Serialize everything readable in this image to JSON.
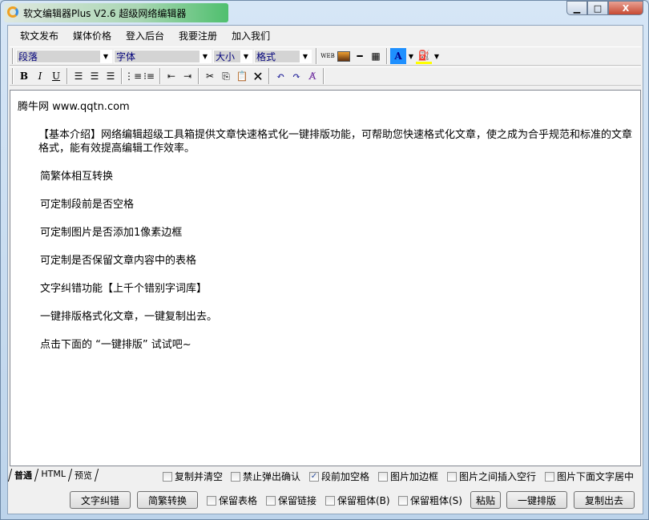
{
  "window": {
    "title": "软文编辑器Plus V2.6 超级网络编辑器",
    "min": "▁",
    "max": "□",
    "close": "X"
  },
  "menu": [
    "软文发布",
    "媒体价格",
    "登入后台",
    "我要注册",
    "加入我们"
  ],
  "toolbar": {
    "paragraph": "段落",
    "font": "字体",
    "size": "大小",
    "format": "格式"
  },
  "editor": {
    "line1": "腾牛网  www.qqtn.com",
    "intro": "【基本介绍】网络编辑超级工具箱提供文章快速格式化一键排版功能，可帮助您快速格式化文章，使之成为合乎规范和标准的文章格式，能有效提高编辑工作效率。",
    "items": [
      "简繁体相互转换",
      "可定制段前是否空格",
      "可定制图片是否添加1像素边框",
      "可定制是否保留文章内容中的表格",
      "文字纠错功能【上千个错别字词库】",
      "一键排版格式化文章，一键复制出去。",
      "点击下面的 “一键排版” 试试吧~"
    ]
  },
  "tabs": [
    "普通",
    "HTML",
    "预览"
  ],
  "options": [
    {
      "label": "复制并清空",
      "checked": false
    },
    {
      "label": "禁止弹出确认",
      "checked": false
    },
    {
      "label": "段前加空格",
      "checked": true
    },
    {
      "label": "图片加边框",
      "checked": false
    },
    {
      "label": "图片之间插入空行",
      "checked": false
    },
    {
      "label": "图片下面文字居中",
      "checked": false
    }
  ],
  "buttons": {
    "correct": "文字纠错",
    "convert": "简繁转换",
    "paste": "粘贴",
    "format": "一键排版",
    "copy": "复制出去"
  },
  "keep": [
    {
      "label": "保留表格",
      "checked": false
    },
    {
      "label": "保留链接",
      "checked": false
    },
    {
      "label": "保留粗体(B)",
      "checked": false
    },
    {
      "label": "保留粗体(S)",
      "checked": false
    }
  ]
}
